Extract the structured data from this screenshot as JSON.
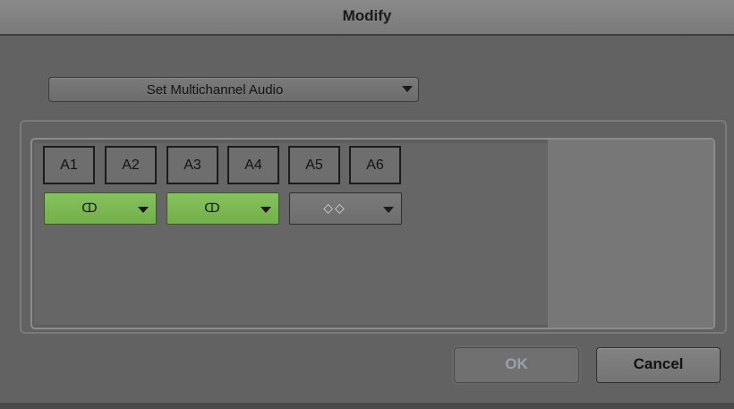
{
  "window": {
    "title": "Modify"
  },
  "mode_select": {
    "value": "Set Multichannel Audio"
  },
  "tracks": [
    "A1",
    "A2",
    "A3",
    "A4",
    "A5",
    "A6"
  ],
  "pairs": [
    {
      "symbol": "ↀ",
      "state": "linked",
      "color": "#7ab850"
    },
    {
      "symbol": "ↀ",
      "state": "linked",
      "color": "#7ab850"
    },
    {
      "symbol": "◇◇",
      "state": "unlinked",
      "color": "#727272"
    }
  ],
  "buttons": {
    "ok_label": "OK",
    "cancel_label": "Cancel"
  }
}
